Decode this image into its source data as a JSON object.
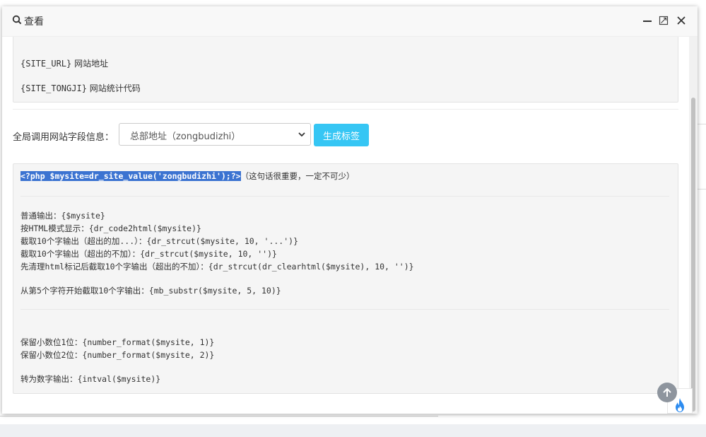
{
  "modal": {
    "title": "查看",
    "icons": {
      "title": "search-icon",
      "minimize": "minimize-icon",
      "maximize": "maximize-icon",
      "close": "close-icon"
    }
  },
  "code_block_top": {
    "lines": [
      {
        "code": "{SITE_URL}",
        "text": " 网站地址"
      },
      {
        "code": "{SITE_TONGJI}",
        "text": " 网站统计代码"
      }
    ]
  },
  "field_selector": {
    "label": "全局调用网站字段信息：",
    "selected": "总部地址（zongbudizhi）",
    "button_label": "生成标签",
    "button_color": "#36c6f4"
  },
  "code_block_main": {
    "selected_line": "<?php $mysite=dr_site_value('zongbudizhi');?>",
    "selected_note": "（这句话很重要，一定不可少）",
    "lines_group1": [
      "普通输出：{$mysite}",
      "按HTML模式显示：{dr_code2html($mysite)}",
      "截取10个字输出（超出的加...）：{dr_strcut($mysite, 10, '...')}",
      "截取10个字输出（超出的不加）：{dr_strcut($mysite, 10, '')}",
      "先清理html标记后截取10个字输出（超出的不加）：{dr_strcut(dr_clearhtml($mysite), 10, '')}"
    ],
    "line_substr": "从第5个字符开始截取10个字输出：{mb_substr($mysite, 5, 10)}",
    "lines_group2": [
      "保留小数位1位：{number_format($mysite, 1)}",
      "保留小数位2位：{number_format($mysite, 2)}"
    ],
    "line_intval": "转为数字输出：{intval($mysite)}"
  },
  "floating": {
    "back_to_top": "arrow-up-icon",
    "fire": "fire-icon"
  },
  "colors": {
    "selection": "#3b73d1",
    "accent": "#36c6f4"
  }
}
